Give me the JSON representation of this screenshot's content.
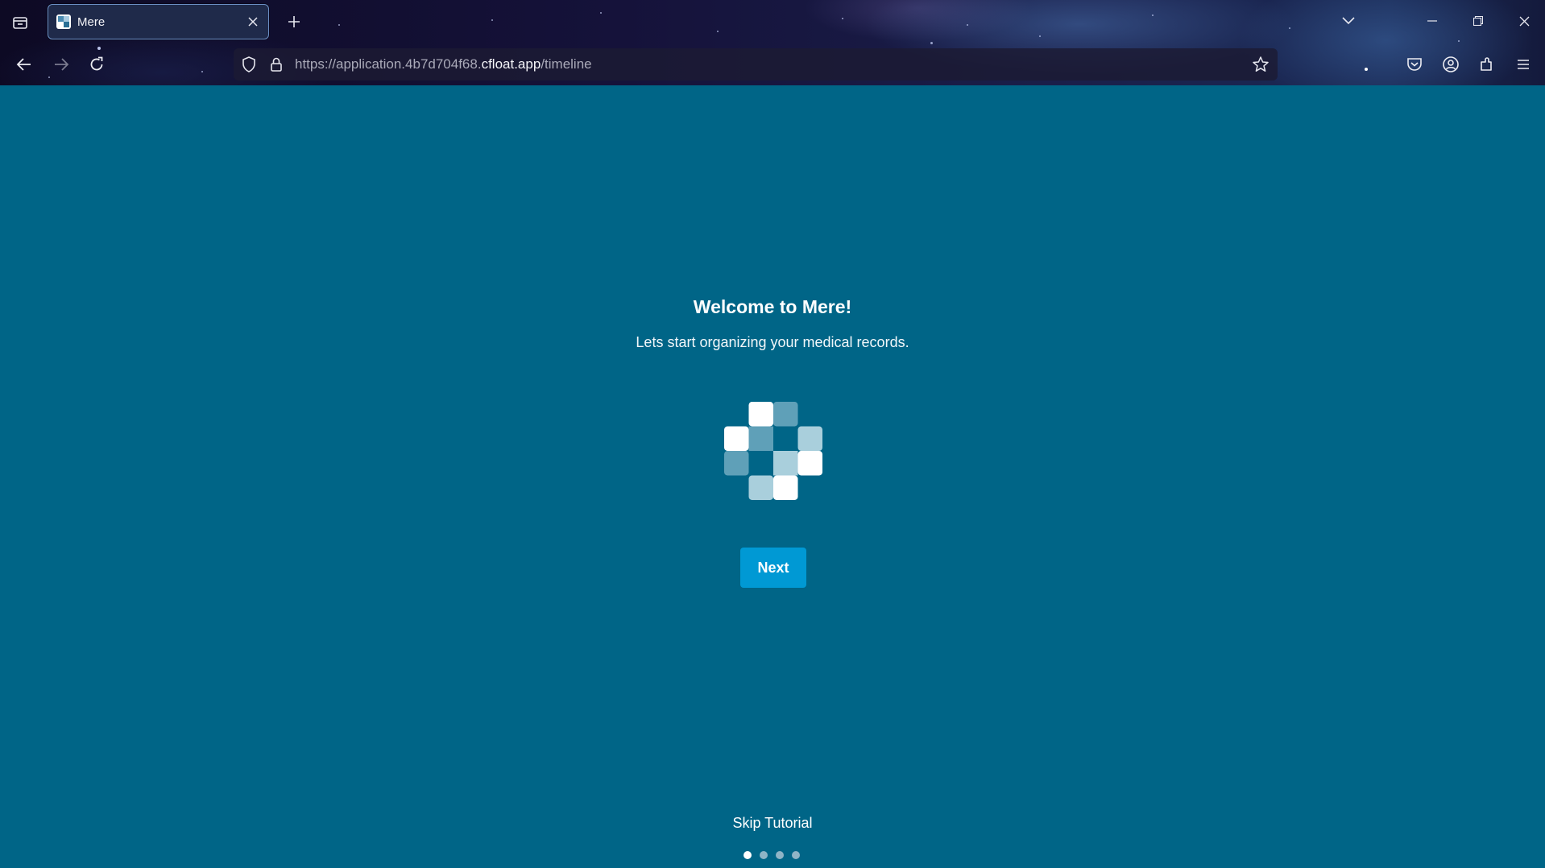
{
  "browser": {
    "tab_title": "Mere",
    "url_prefix": "https://application.4b7d704f68.",
    "url_domain": "cfloat.app",
    "url_path": "/timeline"
  },
  "page": {
    "title": "Welcome to Mere!",
    "subtitle": "Lets start organizing your medical records.",
    "next_label": "Next",
    "skip_label": "Skip Tutorial",
    "steps_total": 4,
    "current_step": 1
  },
  "colors": {
    "page_background": "#006587",
    "button_background": "#0099d4",
    "text": "#ffffff"
  },
  "icons": [
    "tab-list-icon",
    "close-icon",
    "plus-icon",
    "chevron-down-icon",
    "minimize-icon",
    "restore-icon",
    "back-arrow-icon",
    "forward-arrow-icon",
    "reload-icon",
    "shield-icon",
    "lock-icon",
    "star-icon",
    "pocket-icon",
    "account-icon",
    "extensions-icon",
    "menu-icon",
    "mere-logo"
  ]
}
